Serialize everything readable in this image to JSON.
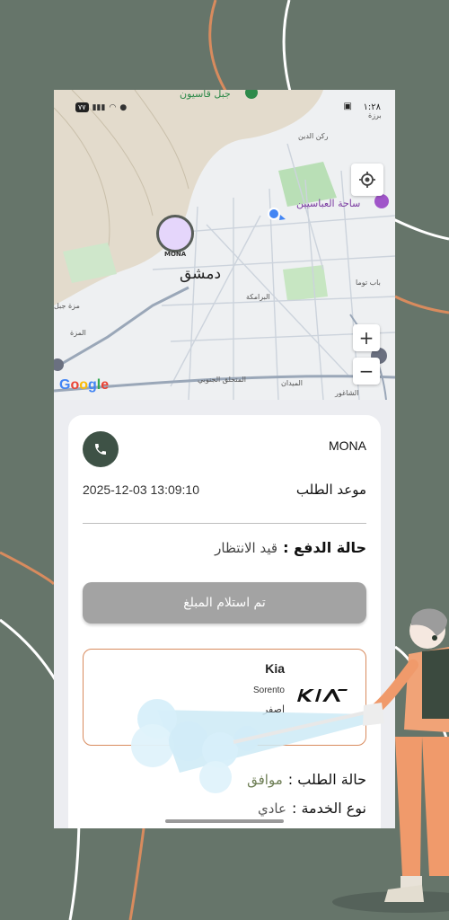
{
  "status_bar": {
    "time": "١:٢٨",
    "battery": "٧٧"
  },
  "map": {
    "labels": {
      "mount": "جبل قاسيون",
      "rukn": "ركن الدين",
      "abbasiyin": "ساحة العباسيين",
      "city": "دمشق",
      "mezze": "مزة جبل",
      "barzeh": "برزة",
      "bab_touma": "باب توما",
      "baramkeh": "البرامكة",
      "midan": "الميدان",
      "shaghour": "الشاغور",
      "mezzeh2": "المزة",
      "south_high": "المتحلق الجنوبي"
    },
    "marker_label": "MONA",
    "zoom_in": "+",
    "zoom_out": "−",
    "google": [
      "G",
      "o",
      "o",
      "g",
      "l",
      "e"
    ]
  },
  "order": {
    "customer_name": "MONA",
    "date_label": "موعد الطلب",
    "date_value": "2025-12-03 13:09:10",
    "payment_label": "حالة الدفع :",
    "payment_value": "قيد الانتظار",
    "received_button": "تم استلام المبلغ",
    "car": {
      "make": "Kia",
      "model": "Sorento",
      "color": "اصفر"
    },
    "status_label": "حالة الطلب :",
    "status_value": "موافق",
    "service_label": "نوع الخدمة :",
    "service_value": "عادي"
  },
  "colors": {
    "background": "#66756a",
    "call_button": "#3e5246",
    "accent_orange": "#d88b5e",
    "marker_fill": "#e5d6fb"
  }
}
